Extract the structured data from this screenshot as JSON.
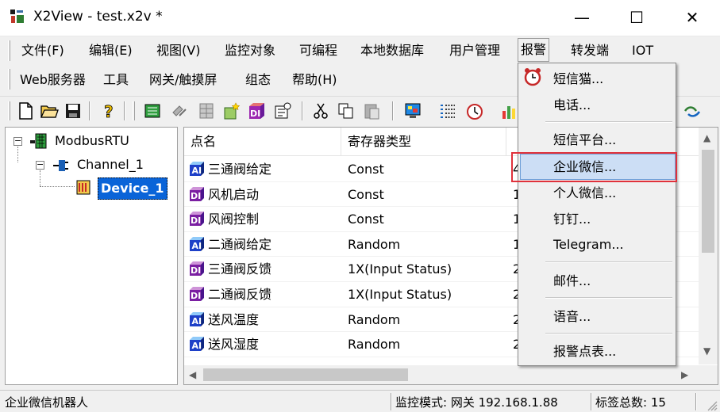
{
  "window": {
    "title": "X2View - test.x2v *",
    "minimize_glyph": "—",
    "maximize_glyph": "☐",
    "close_glyph": "✕"
  },
  "menu": {
    "row1": [
      "文件(F)",
      "编辑(E)",
      "视图(V)",
      "监控对象",
      "可编程",
      "本地数据库",
      "用户管理",
      "报警",
      "转发端",
      "IOT"
    ],
    "row2": [
      "Web服务器",
      "工具",
      "网关/触摸屏",
      "组态",
      "帮助(H)"
    ],
    "active": "报警"
  },
  "toolbar": {
    "buttons": [
      "new-icon",
      "open-icon",
      "save-icon",
      "help-icon",
      "device-icon",
      "link-icon",
      "table-icon",
      "new-tag-icon",
      "tag-di-icon",
      "properties-icon",
      "cut-icon",
      "copy-icon",
      "paste-icon",
      "monitor-icon",
      "list-icon",
      "timer-icon",
      "chart-icon",
      "sync-icon"
    ]
  },
  "tree": {
    "root": "ModbusRTU",
    "channel": "Channel_1",
    "device": "Device_1"
  },
  "list": {
    "columns": [
      "点名",
      "寄存器类型"
    ],
    "rows": [
      {
        "icon": "AI",
        "name": "三通阀给定",
        "type": "Const",
        "c3": "4"
      },
      {
        "icon": "DI",
        "name": "风机启动",
        "type": "Const",
        "c3": "1"
      },
      {
        "icon": "DI",
        "name": "风阀控制",
        "type": "Const",
        "c3": "1"
      },
      {
        "icon": "AI",
        "name": "二通阀给定",
        "type": "Random",
        "c3": "1"
      },
      {
        "icon": "DI",
        "name": "三通阀反馈",
        "type": "1X(Input Status)",
        "c3": "2"
      },
      {
        "icon": "DI",
        "name": "二通阀反馈",
        "type": "1X(Input Status)",
        "c3": "2"
      },
      {
        "icon": "AI",
        "name": "送风温度",
        "type": "Random",
        "c3": "2"
      },
      {
        "icon": "AI",
        "name": "送风湿度",
        "type": "Random",
        "c3": "2"
      }
    ]
  },
  "alarm_menu": {
    "items": [
      "短信猫...",
      "电话...",
      "短信平台...",
      "企业微信...",
      "个人微信...",
      "钉钉...",
      "Telegram...",
      "邮件...",
      "语音...",
      "报警点表..."
    ],
    "highlighted": "企业微信..."
  },
  "status": {
    "left": "企业微信机器人",
    "mode": "监控模式: 网关 192.168.1.88",
    "tags": "标签总数: 15"
  },
  "colors": {
    "selection": "#0a64d8",
    "menu_highlight": "#ccdef5",
    "annotation_box": "#e0313b"
  }
}
